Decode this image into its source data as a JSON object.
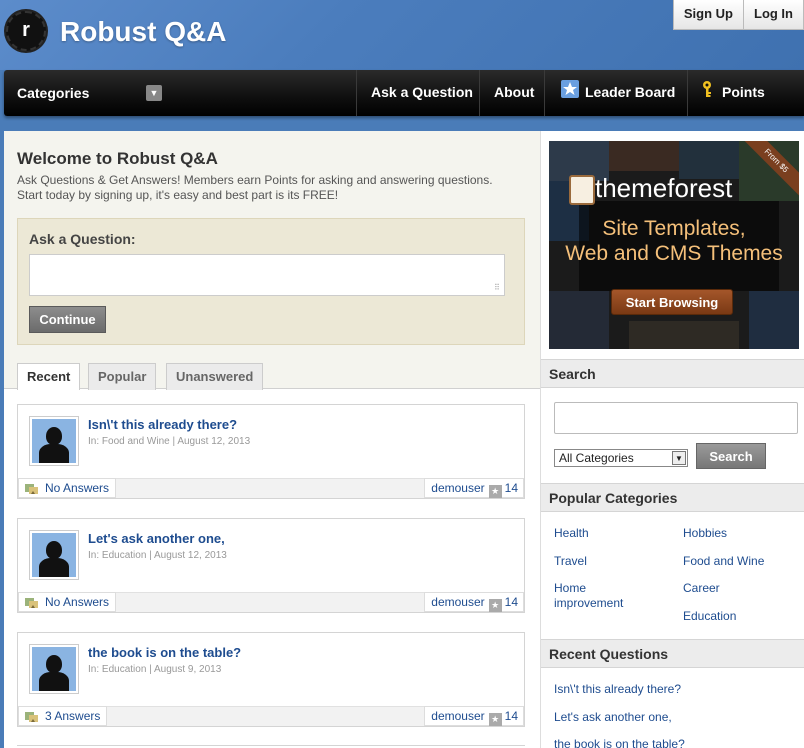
{
  "site": {
    "logo_letter": "r",
    "title": "Robust Q&A"
  },
  "auth": {
    "signup": "Sign Up",
    "login": "Log In"
  },
  "nav": {
    "categories": "Categories",
    "ask": "Ask a Question",
    "about": "About",
    "leaderboard": "Leader Board",
    "pointskey": "Points Key"
  },
  "welcome": {
    "title": "Welcome to Robust Q&A",
    "line1": "Ask Questions & Get Answers! Members earn Points for asking and answering questions.",
    "line2": "Start today by signing up, it's easy and best part is its FREE!",
    "ask_label": "Ask a Question:",
    "continue": "Continue"
  },
  "tabs": [
    "Recent",
    "Popular",
    "Unanswered"
  ],
  "questions": [
    {
      "title": "Isn\\'t this already there?",
      "meta": "In: Food and Wine | August 12, 2013",
      "answers": "No Answers",
      "user": "demouser",
      "points": "14"
    },
    {
      "title": "Let's ask another one,",
      "meta": "In: Education | August 12, 2013",
      "answers": "No Answers",
      "user": "demouser",
      "points": "14"
    },
    {
      "title": "the book is on the table?",
      "meta": "In: Education | August 9, 2013",
      "answers": "3 Answers",
      "user": "demouser",
      "points": "14"
    }
  ],
  "ad": {
    "ribbon": "From $5",
    "brand": "themeforest",
    "line1": "Site Templates,",
    "line2": "Web and CMS Themes",
    "button": "Start Browsing"
  },
  "search": {
    "heading": "Search",
    "category_selected": "All Categories",
    "button": "Search"
  },
  "popular_categories": {
    "heading": "Popular Categories",
    "left": [
      "Health",
      "Travel",
      "Home improvement"
    ],
    "right": [
      "Hobbies",
      "Food and Wine",
      "Career",
      "Education"
    ]
  },
  "recent_questions": {
    "heading": "Recent Questions",
    "items": [
      "Isn\\'t this already there?",
      "Let's ask another one,",
      "the book is on the table?"
    ]
  }
}
